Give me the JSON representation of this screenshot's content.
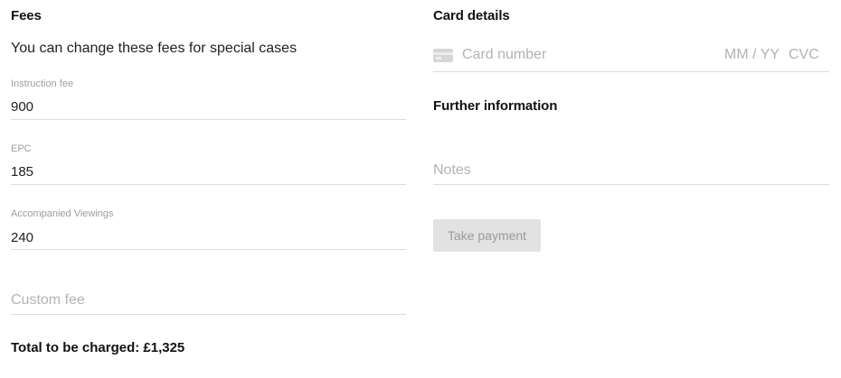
{
  "fees": {
    "title": "Fees",
    "subtitle": "You can change these fees for special cases",
    "fields": [
      {
        "label": "Instruction fee",
        "value": "900"
      },
      {
        "label": "EPC",
        "value": "185"
      },
      {
        "label": "Accompanied Viewings",
        "value": "240"
      }
    ],
    "custom_fee_placeholder": "Custom fee",
    "total_text": "Total to be charged: £1,325"
  },
  "card": {
    "title": "Card details",
    "icon": "credit-card-icon",
    "number_placeholder": "Card number",
    "expiry_placeholder": "MM / YY",
    "cvc_placeholder": "CVC"
  },
  "further": {
    "title": "Further information",
    "notes_placeholder": "Notes"
  },
  "payment": {
    "button_label": "Take payment"
  }
}
